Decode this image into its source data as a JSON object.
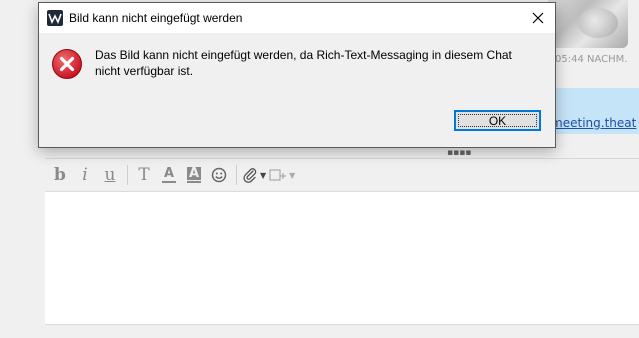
{
  "chat": {
    "message_time": "05:44 NACHM.",
    "message_link": "/meeting.theat",
    "splitter_grip": "▪▪▪▪"
  },
  "toolbar": {
    "bold": "b",
    "italic": "i",
    "underline": "u",
    "text": "T",
    "font_color": "A",
    "background_color": "A",
    "emoji": "☺",
    "attach": "📎",
    "attach_caret": "▼",
    "insert_caret": "▼",
    "icons": [
      "bold-icon",
      "italic-icon",
      "underline-icon",
      "text-format-icon",
      "font-color-icon",
      "background-color-icon",
      "emoji-icon",
      "paperclip-icon",
      "insert-screenshot-icon"
    ]
  },
  "dialog": {
    "title": "Bild kann nicht eingefügt werden",
    "message": "Das Bild kann nicht eingefügt werden, da Rich-Text-Messaging in diesem Chat nicht verfügbar ist.",
    "ok_label": "OK",
    "icon": "error-icon",
    "colors": {
      "error_red": "#e81123",
      "focus_blue": "#0078d7",
      "title_bg": "#ffffff"
    }
  }
}
